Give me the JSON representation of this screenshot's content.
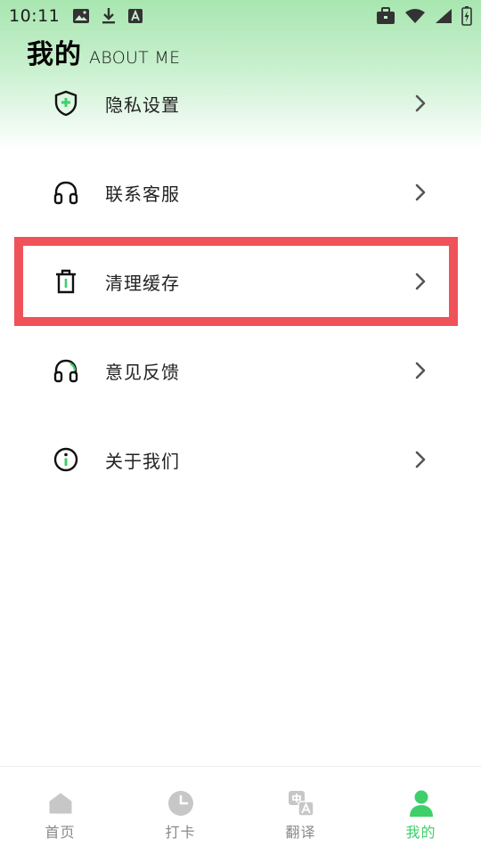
{
  "status_bar": {
    "time": "10:11",
    "left_icons": [
      "image-icon",
      "download-icon",
      "text-a-icon"
    ],
    "right_icons": [
      "briefcase-icon",
      "wifi-icon",
      "signal-icon",
      "battery-icon"
    ]
  },
  "header": {
    "title": "我的",
    "subtitle": "ABOUT ME"
  },
  "menu": {
    "items": [
      {
        "label": "隐私设置",
        "icon": "shield-icon"
      },
      {
        "label": "联系客服",
        "icon": "headphones-icon"
      },
      {
        "label": "清理缓存",
        "icon": "trash-icon"
      },
      {
        "label": "意见反馈",
        "icon": "headphones-icon"
      },
      {
        "label": "关于我们",
        "icon": "info-icon"
      }
    ]
  },
  "tabs": [
    {
      "label": "首页",
      "icon": "home-icon",
      "active": false
    },
    {
      "label": "打卡",
      "icon": "clock-icon",
      "active": false
    },
    {
      "label": "翻译",
      "icon": "translate-icon",
      "active": false
    },
    {
      "label": "我的",
      "icon": "person-icon",
      "active": true
    }
  ],
  "colors": {
    "accent_green": "#3ecf6b",
    "highlight_red": "#f0525a",
    "gradient_top": "#a8e6b0",
    "inactive_gray": "#888888"
  }
}
